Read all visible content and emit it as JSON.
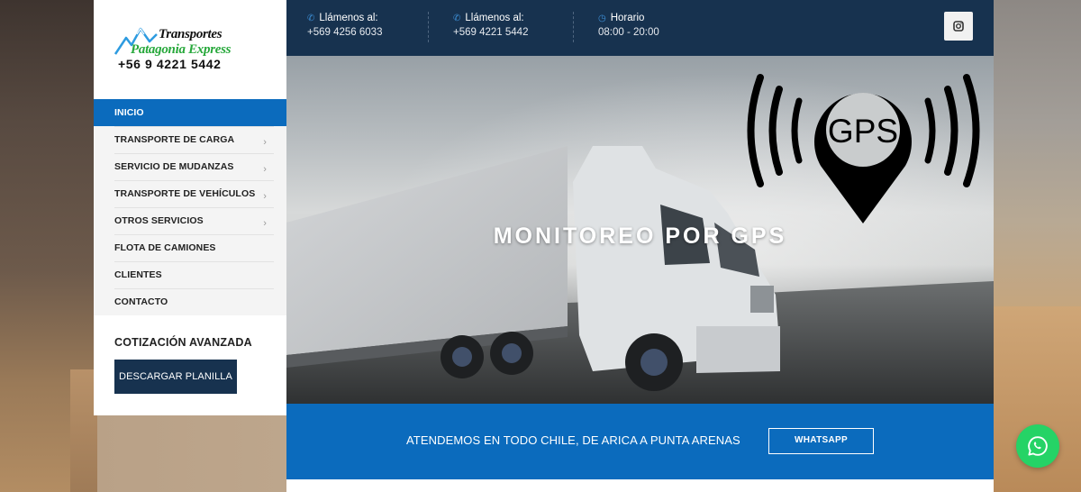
{
  "brand": {
    "line1": "Transportes",
    "line2": "Patagonia Express",
    "phone": "+56 9 4221 5442"
  },
  "nav": {
    "items": [
      {
        "label": "INICIO",
        "active": true,
        "submenu": false
      },
      {
        "label": "TRANSPORTE DE CARGA",
        "active": false,
        "submenu": true
      },
      {
        "label": "SERVICIO DE MUDANZAS",
        "active": false,
        "submenu": true
      },
      {
        "label": "TRANSPORTE DE VEHÍCULOS",
        "active": false,
        "submenu": true
      },
      {
        "label": "OTROS SERVICIOS",
        "active": false,
        "submenu": true
      },
      {
        "label": "FLOTA DE CAMIONES",
        "active": false,
        "submenu": false
      },
      {
        "label": "CLIENTES",
        "active": false,
        "submenu": false
      },
      {
        "label": "CONTACTO",
        "active": false,
        "submenu": false
      }
    ],
    "chevron": "›"
  },
  "cotizacion": {
    "title": "COTIZACIÓN AVANZADA",
    "button": "DESCARGAR PLANILLA"
  },
  "topbar": {
    "contacts": [
      {
        "icon": "phone-icon",
        "label": "Llámenos al:",
        "value": "+569 4256 6033"
      },
      {
        "icon": "phone-icon",
        "label": "Llámenos al:",
        "value": "+569 4221 5442"
      },
      {
        "icon": "clock-icon",
        "label": "Horario",
        "value": "08:00 - 20:00"
      }
    ],
    "social": "instagram-icon"
  },
  "hero": {
    "title": "MONITOREO POR GPS",
    "gps_badge": "GPS"
  },
  "banner": {
    "text": "ATENDEMOS EN TODO CHILE, DE ARICA A PUNTA ARENAS",
    "button": "WHATSAPP"
  },
  "colors": {
    "primary_blue": "#0b6bbd",
    "navy": "#17324f",
    "whatsapp_green": "#25d366"
  }
}
